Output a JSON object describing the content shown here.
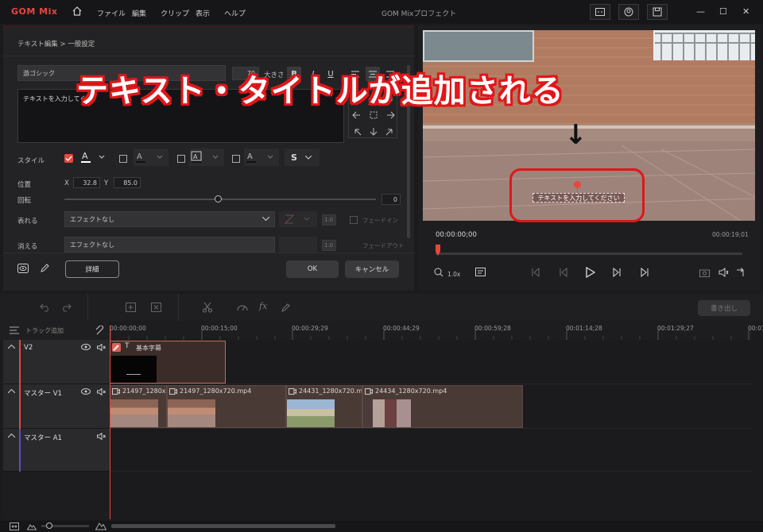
{
  "app": {
    "logo": "GOM Mix",
    "window_title": "GOM Mixプロフェクト",
    "menu": [
      "ファイル",
      "編集",
      "クリップ",
      "表示",
      "ヘルプ"
    ]
  },
  "text_editor": {
    "breadcrumb": "テキスト編集 > 一般設定",
    "font_name": "游ゴシック",
    "font_size": "70",
    "size_label": "大きさ",
    "bold": "B",
    "italic": "I",
    "underline": "U",
    "text_value": "テキストを入力してくだ",
    "style_label": "スタイル",
    "shadow_letter": "S",
    "position_label": "位置",
    "x_label": "X",
    "x_value": "32.8",
    "y_label": "Y",
    "y_value": "85.0",
    "rotation_label": "回転",
    "rotation_value": "0",
    "appear_label": "表れる",
    "appear_effect": "エフェクトなし",
    "appear_duration": "1.0",
    "appear_fade": "フェードイン",
    "disappear_label": "消える",
    "disappear_effect": "エフェクトなし",
    "disappear_duration": "1.0",
    "disappear_fade": "フェードアウト",
    "details_button": "詳細",
    "ok_button": "OK",
    "cancel_button": "キャンセル",
    "colors": {
      "accent": "#e8463f",
      "panel": "#232325"
    }
  },
  "preview": {
    "overlay_text": "テキストを入力してください",
    "annotation": "テキスト・タイトルが追加される",
    "annotation_arrow": "↓",
    "time_current": "00:00:00;00",
    "time_total": "00:00:19;01",
    "zoom": "1.0x"
  },
  "timeline": {
    "export_button": "書き出し",
    "add_track": "トラック追加",
    "ruler": [
      "00:00:00;00",
      "00:00:15;00",
      "00:00:29;29",
      "00:00:44;29",
      "00:00:59;28",
      "00:01:14;28",
      "00:01:29;27",
      "00:01:44;27"
    ],
    "tracks": [
      {
        "name": "V2",
        "clips": [
          {
            "title": "基本字幕"
          }
        ]
      },
      {
        "name": "マスター V1",
        "clips": [
          {
            "title": "21497_1280x..."
          },
          {
            "title": "21497_1280x720.mp4"
          },
          {
            "title": "24431_1280x720.m..."
          },
          {
            "title": "24434_1280x720.mp4"
          }
        ]
      },
      {
        "name": "マスター A1",
        "clips": []
      }
    ]
  }
}
